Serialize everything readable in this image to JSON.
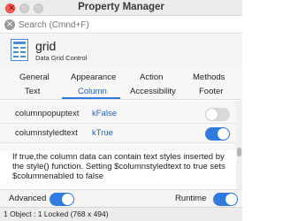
{
  "window": {
    "title": "Property Manager"
  },
  "search": {
    "placeholder": "Search (Cmnd+F)"
  },
  "object": {
    "name": "grid",
    "type": "Data Grid Control",
    "icon": "data-grid-icon"
  },
  "tabs": {
    "row1": [
      "General",
      "Appearance",
      "Action",
      "Methods"
    ],
    "row2": [
      "Text",
      "Column",
      "Accessibility",
      "Footer"
    ],
    "active": "Column"
  },
  "properties": [
    {
      "name": "columnpopuptext",
      "value": "kFalse",
      "enabled": false
    },
    {
      "name": "columnstyledtext",
      "value": "kTrue",
      "enabled": true
    }
  ],
  "description": "If true,the column data can contain text styles inserted by the style() function. Setting $columnstyledtext to true sets $columnenabled to false",
  "bottom": {
    "advanced_label": "Advanced",
    "advanced_on": true,
    "runtime_label": "Runtime",
    "runtime_on": true
  },
  "status": "1 Object : 1 Locked (768 x 494)",
  "colors": {
    "accent": "#2f7be0",
    "value_text": "#1a62c7"
  }
}
